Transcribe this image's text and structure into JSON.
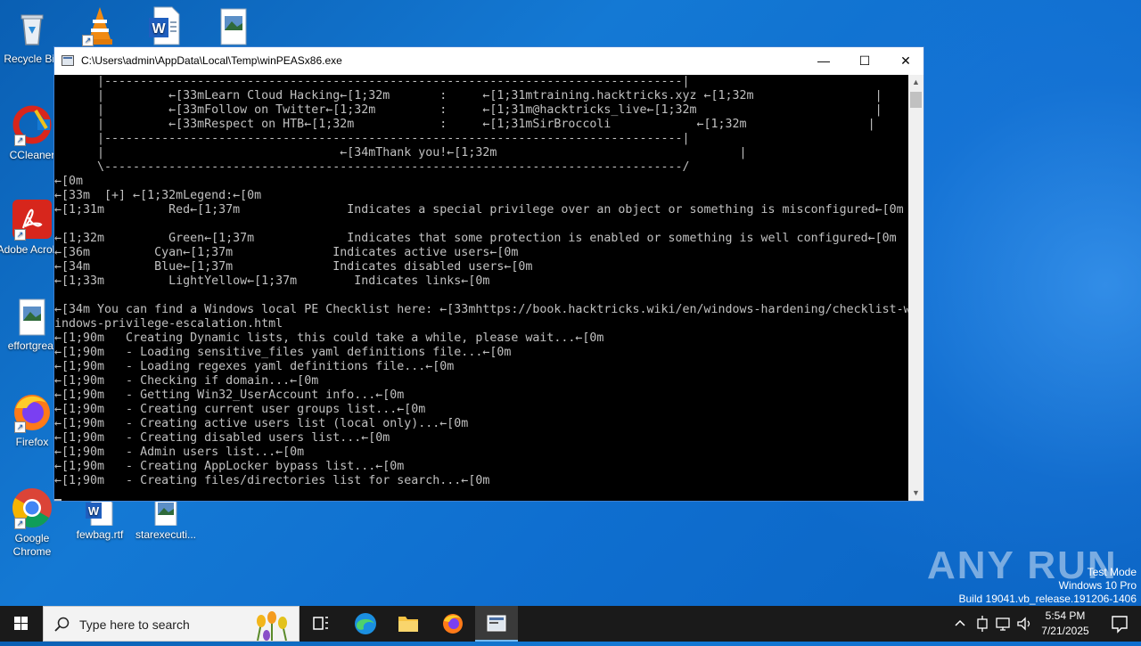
{
  "desktop_icons": [
    {
      "label": "Recycle Bin",
      "icon": "recycle-bin-icon"
    },
    {
      "label": "",
      "icon": "vlc-icon"
    },
    {
      "label": "",
      "icon": "word-document-icon"
    },
    {
      "label": "",
      "icon": "image-file-icon"
    },
    {
      "label": "CCleaner",
      "icon": "ccleaner-icon"
    },
    {
      "label": "Adobe Acrobat",
      "icon": "acrobat-icon"
    },
    {
      "label": "effortgreat",
      "icon": "image-file-icon"
    },
    {
      "label": "Firefox",
      "icon": "firefox-icon"
    },
    {
      "label": "Google Chrome",
      "icon": "chrome-icon"
    },
    {
      "label": "fewbag.rtf",
      "icon": "word-document-icon"
    },
    {
      "label": "starexecuti...",
      "icon": "image-file-icon"
    }
  ],
  "window": {
    "title": "C:\\Users\\admin\\AppData\\Local\\Temp\\winPEASx86.exe",
    "minimize": "—",
    "maximize": "☐",
    "close": "✕"
  },
  "console": {
    "lines": [
      "      |---------------------------------------------------------------------------------|",
      "      |         ←[33mLearn Cloud Hacking←[1;32m       :     ←[1;31mtraining.hacktricks.xyz ←[1;32m                 |",
      "      |         ←[33mFollow on Twitter←[1;32m         :     ←[1;31m@hacktricks_live←[1;32m                         |",
      "      |         ←[33mRespect on HTB←[1;32m            :     ←[1;31mSirBroccoli            ←[1;32m                 |",
      "      |---------------------------------------------------------------------------------|",
      "      |                                 ←[34mThank you!←[1;32m                                  |",
      "      \\---------------------------------------------------------------------------------/",
      "←[0m",
      "←[33m  [+] ←[1;32mLegend:←[0m",
      "←[1;31m         Red←[1;37m               Indicates a special privilege over an object or something is misconfigured←[0m",
      "",
      "←[1;32m         Green←[1;37m             Indicates that some protection is enabled or something is well configured←[0m",
      "←[36m         Cyan←[1;37m              Indicates active users←[0m",
      "←[34m         Blue←[1;37m              Indicates disabled users←[0m",
      "←[1;33m         LightYellow←[1;37m        Indicates links←[0m",
      "",
      "←[34m You can find a Windows local PE Checklist here: ←[33mhttps://book.hacktricks.wiki/en/windows-hardening/checklist-w",
      "indows-privilege-escalation.html",
      "←[1;90m   Creating Dynamic lists, this could take a while, please wait...←[0m",
      "←[1;90m   - Loading sensitive_files yaml definitions file...←[0m",
      "←[1;90m   - Loading regexes yaml definitions file...←[0m",
      "←[1;90m   - Checking if domain...←[0m",
      "←[1;90m   - Getting Win32_UserAccount info...←[0m",
      "←[1;90m   - Creating current user groups list...←[0m",
      "←[1;90m   - Creating active users list (local only)...←[0m",
      "←[1;90m   - Creating disabled users list...←[0m",
      "←[1;90m   - Admin users list...←[0m",
      "←[1;90m   - Creating AppLocker bypass list...←[0m",
      "←[1;90m   - Creating files/directories list for search...←[0m"
    ]
  },
  "watermark": {
    "brand": "ANY RUN",
    "line1": "Test Mode",
    "line2": "Windows 10 Pro",
    "line3": "Build 19041.vb_release.191206-1406"
  },
  "taskbar": {
    "search_placeholder": "Type here to search",
    "time": "5:54 PM",
    "date": "7/21/2025"
  }
}
